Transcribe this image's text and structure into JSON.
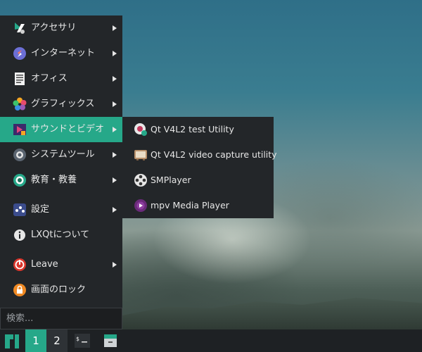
{
  "menu": {
    "items": [
      {
        "label": "アクセサリ",
        "icon": "accessories-icon",
        "submenu": true
      },
      {
        "label": "インターネット",
        "icon": "internet-icon",
        "submenu": true
      },
      {
        "label": "オフィス",
        "icon": "office-icon",
        "submenu": true
      },
      {
        "label": "グラフィックス",
        "icon": "graphics-icon",
        "submenu": true
      },
      {
        "label": "サウンドとビデオ",
        "icon": "sound-video-icon",
        "submenu": true,
        "active": true
      },
      {
        "label": "システムツール",
        "icon": "system-tools-icon",
        "submenu": true
      },
      {
        "label": "教育・教養",
        "icon": "education-icon",
        "submenu": true
      },
      {
        "label": "設定",
        "icon": "settings-icon",
        "submenu": true
      },
      {
        "label": "LXQtについて",
        "icon": "info-icon",
        "submenu": false
      },
      {
        "label": "Leave",
        "icon": "power-icon",
        "submenu": true
      },
      {
        "label": "画面のロック",
        "icon": "lock-icon",
        "submenu": false
      }
    ],
    "search_placeholder": "検索..."
  },
  "submenu": {
    "items": [
      {
        "label": "Qt V4L2 test Utility",
        "icon": "webcam-test-icon"
      },
      {
        "label": "Qt V4L2 video capture utility",
        "icon": "tv-icon"
      },
      {
        "label": "SMPlayer",
        "icon": "film-reel-icon"
      },
      {
        "label": "mpv Media Player",
        "icon": "mpv-icon"
      }
    ]
  },
  "taskbar": {
    "desktops": [
      "1",
      "2"
    ],
    "active_desktop": "1"
  },
  "colors": {
    "accent": "#26a889",
    "panel": "#232629",
    "taskbar": "#1e2124"
  }
}
